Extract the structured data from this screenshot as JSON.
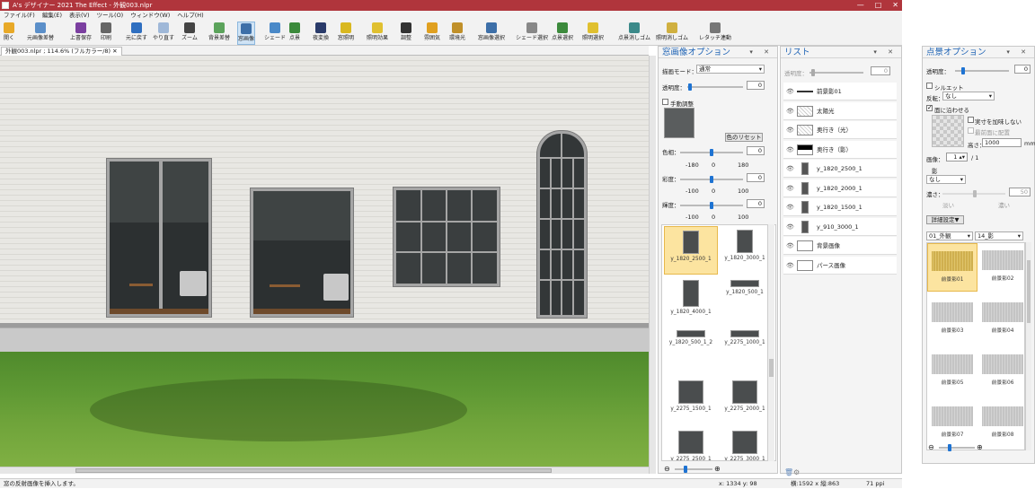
{
  "window": {
    "title": "A's デザイナー 2021 The Effect - 外観003.nlpr",
    "controls": [
      "—",
      "□",
      "✕"
    ]
  },
  "menu": [
    "ファイル(F)",
    "編集(E)",
    "表示(V)",
    "ツール(O)",
    "ウィンドウ(W)",
    "ヘルプ(H)"
  ],
  "toolbar": [
    {
      "label": "開く",
      "icon": "open-icon",
      "color": "#e8a928"
    },
    {
      "label": "元画像差替",
      "icon": "swap-image-icon",
      "color": "#5b8fc9"
    },
    {
      "label": "上書保存",
      "icon": "save-icon",
      "color": "#7b3fa0"
    },
    {
      "label": "印刷",
      "icon": "print-icon",
      "color": "#666666"
    },
    {
      "label": "元に戻す",
      "icon": "undo-icon",
      "color": "#2f6fc0"
    },
    {
      "label": "やり直す",
      "icon": "redo-icon",
      "color": "#9fb8d8"
    },
    {
      "label": "ズーム",
      "icon": "zoom-icon",
      "color": "#444444"
    },
    {
      "label": "背景差替",
      "icon": "background-icon",
      "color": "#5ba35b"
    },
    {
      "label": "窓画像",
      "icon": "window-image-icon",
      "color": "#3d6fa8"
    },
    {
      "label": "シェード",
      "icon": "shade-icon",
      "color": "#4a89c8"
    },
    {
      "label": "点景",
      "icon": "tree-icon",
      "color": "#3c8a3c"
    },
    {
      "label": "夜変換",
      "icon": "night-icon",
      "color": "#2a3b6a"
    },
    {
      "label": "窓照明",
      "icon": "window-light-icon",
      "color": "#d9b820"
    },
    {
      "label": "照明効果",
      "icon": "light-effect-icon",
      "color": "#e0c030"
    },
    {
      "label": "調整",
      "icon": "adjust-icon",
      "color": "#333333"
    },
    {
      "label": "雰囲気",
      "icon": "atmosphere-icon",
      "color": "#e0a020"
    },
    {
      "label": "環境光",
      "icon": "ambient-icon",
      "color": "#c0902a"
    },
    {
      "label": "窓画像選択",
      "icon": "window-select-icon",
      "color": "#3d6fa8"
    },
    {
      "label": "シェード選択",
      "icon": "shade-select-icon",
      "color": "#888888"
    },
    {
      "label": "点景選択",
      "icon": "tree-select-icon",
      "color": "#3c8a3c"
    },
    {
      "label": "照明選択",
      "icon": "light-select-icon",
      "color": "#e0c030"
    },
    {
      "label": "点景消しゴム",
      "icon": "tree-eraser-icon",
      "color": "#3c8a8a"
    },
    {
      "label": "照明消しゴム",
      "icon": "light-eraser-icon",
      "color": "#d0b040"
    },
    {
      "label": "レタッチ連動",
      "icon": "retouch-icon",
      "color": "#777777"
    }
  ],
  "doc_tab": "外観003.nlpr ; 114.6% (フルカラー/8)",
  "status": {
    "message": "窓の反射画像を挿入します。",
    "coords": "x: 1334 y: 98",
    "size": "横:1592 x 縦:863",
    "ppi": "71 ppi"
  },
  "window_options": {
    "title": "窓画像オプション",
    "draw_mode_label": "描画モード：",
    "draw_mode": "通常",
    "opacity_label": "透明度：",
    "opacity": "0",
    "opacity_fraction": 0.05,
    "manual_label": "手動調整",
    "manual_checked": false,
    "color_reset": "色のリセット",
    "hue_label": "色相：",
    "hue": "0",
    "hue_min": "-180",
    "hue_mid": "0",
    "hue_max": "180",
    "hue_fraction": 0.5,
    "sat_label": "彩度：",
    "sat": "0",
    "sat_min": "-100",
    "sat_mid": "0",
    "sat_max": "100",
    "sat_fraction": 0.5,
    "bri_label": "輝度：",
    "bri": "0",
    "bri_min": "-100",
    "bri_mid": "0",
    "bri_max": "100",
    "bri_fraction": 0.5,
    "thumbnails": [
      "y_1820_2500_1",
      "y_1820_3000_1",
      "y_1820_4000_1",
      "y_1820_500_1",
      "y_1820_500_1_2",
      "y_2275_1000_1",
      "y_2275_1500_1",
      "y_2275_2000_1",
      "y_2275_2500_1",
      "y_2275_3000_1"
    ],
    "selected": "y_1820_2500_1",
    "zoom_minus": "⊖",
    "zoom_plus": "⊕"
  },
  "list": {
    "title": "リスト",
    "opacity_label": "透明度：",
    "opacity": "0",
    "items": [
      "前景影01",
      "太陽光",
      "奥行き（光）",
      "奥行き（影）",
      "y_1820_2500_1",
      "y_1820_2000_1",
      "y_1820_1500_1",
      "y_910_3000_1",
      "背景画像",
      "パース画像"
    ]
  },
  "scenery_options": {
    "title": "点景オプション",
    "opacity_label": "透明度：",
    "opacity": "0",
    "opacity_fraction": 0.15,
    "silhouette_label": "シルエット",
    "silhouette_checked": false,
    "flip_label": "反転：",
    "flip": "なし",
    "fit_label": "面に沿わせる",
    "fit_checked": true,
    "no_dim_label": "実寸を加味しない",
    "no_dim_checked": false,
    "front_label": "最前面に配置",
    "height_label": "高さ：",
    "height": "1000",
    "height_unit": "mm",
    "frame_label": "画像：",
    "frame": "1",
    "frame_total": "/ 1",
    "shadow_label": "影",
    "shadow": "なし",
    "density_label": "濃さ：",
    "density": "50",
    "density_low": "淡い",
    "density_high": "濃い",
    "detail_btn": "詳細設定▼",
    "category": "01_外観",
    "subcategory": "14_影",
    "items": [
      "前景影01",
      "前景影02",
      "前景影03",
      "前景影04",
      "前景影05",
      "前景影06",
      "前景影07",
      "前景影08"
    ],
    "selected": "前景影01"
  }
}
